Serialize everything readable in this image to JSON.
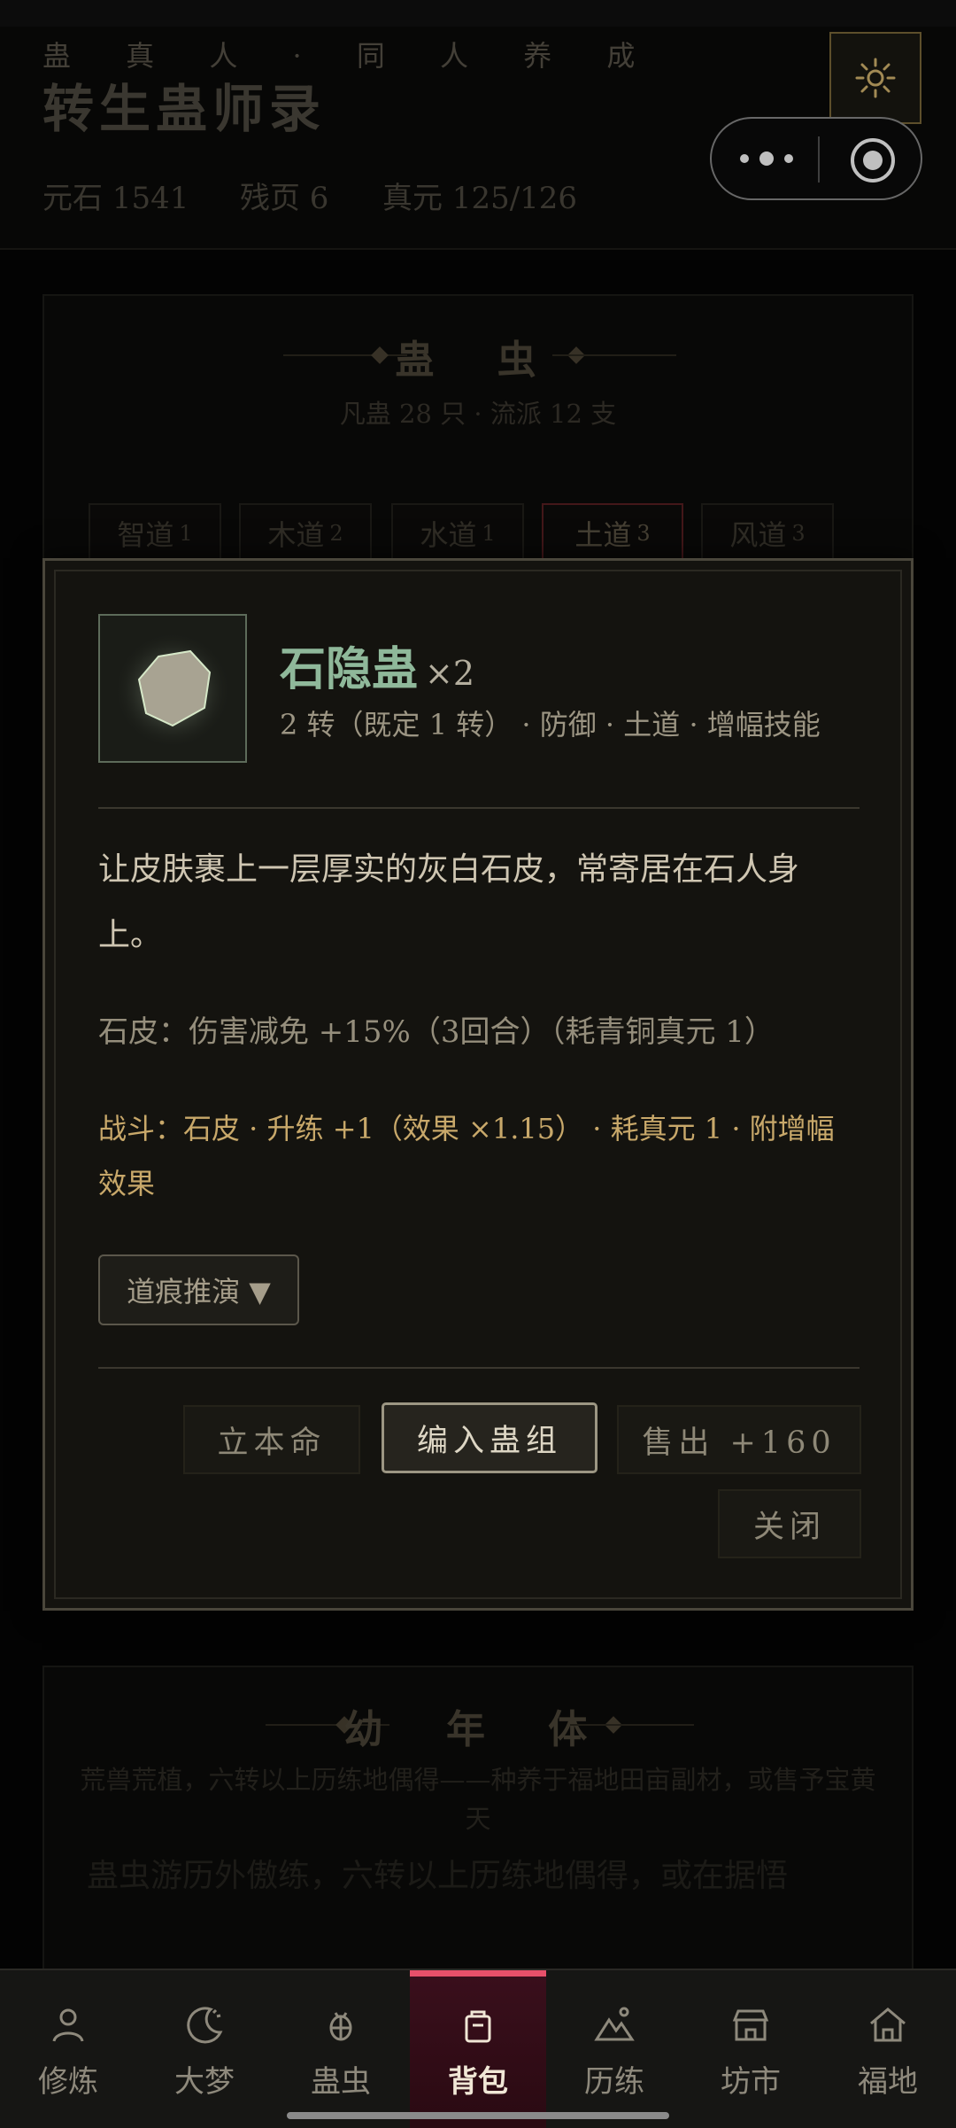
{
  "header": {
    "subtitle": "蛊 真 人 · 同 人 养 成",
    "title": "转生蛊师录",
    "resources": [
      "元石 1541",
      "残页 6",
      "真元 125/126"
    ]
  },
  "gu_panel": {
    "title": "蛊 虫",
    "subtitle": "凡蛊 28 只 · 流派 12 支",
    "tabs": [
      {
        "label": "智道",
        "count": "1"
      },
      {
        "label": "木道",
        "count": "2"
      },
      {
        "label": "水道",
        "count": "1"
      },
      {
        "label": "土道",
        "count": "3"
      },
      {
        "label": "风道",
        "count": "3"
      }
    ]
  },
  "young_panel": {
    "title": "幼 年 体",
    "description": "荒兽荒植，六转以上历练地偶得——种养于福地田亩副材，或售予宝黄天",
    "tail_text": "蛊虫游历外傲练，六转以上历练地偶得，或在据悟"
  },
  "modal": {
    "name": "石隐蛊",
    "count": "×2",
    "meta": "2 转（既定 1 转） · 防御 · 土道 · 增幅技能",
    "description": "让皮肤裹上一层厚实的灰白石皮，常寄居在石人身上。",
    "skill": "石皮：伤害减免 +15%（3回合）（耗青铜真元 1）",
    "battle": "战斗：石皮 · 升练 +1（效果 ×1.15） · 耗真元 1 · 附增幅效果",
    "derive_label": "道痕推演 ▼",
    "buttons": {
      "benming": "立本命",
      "add_group": "编入蛊组",
      "sell": "售出 +160",
      "close": "关闭"
    }
  },
  "nav": {
    "items": [
      "修炼",
      "大梦",
      "蛊虫",
      "背包",
      "历练",
      "坊市",
      "福地"
    ],
    "active": "背包"
  },
  "colors": {
    "accent": "#e8506a",
    "name_green": "#8fb89a",
    "battle_gold": "#c8a86a"
  }
}
